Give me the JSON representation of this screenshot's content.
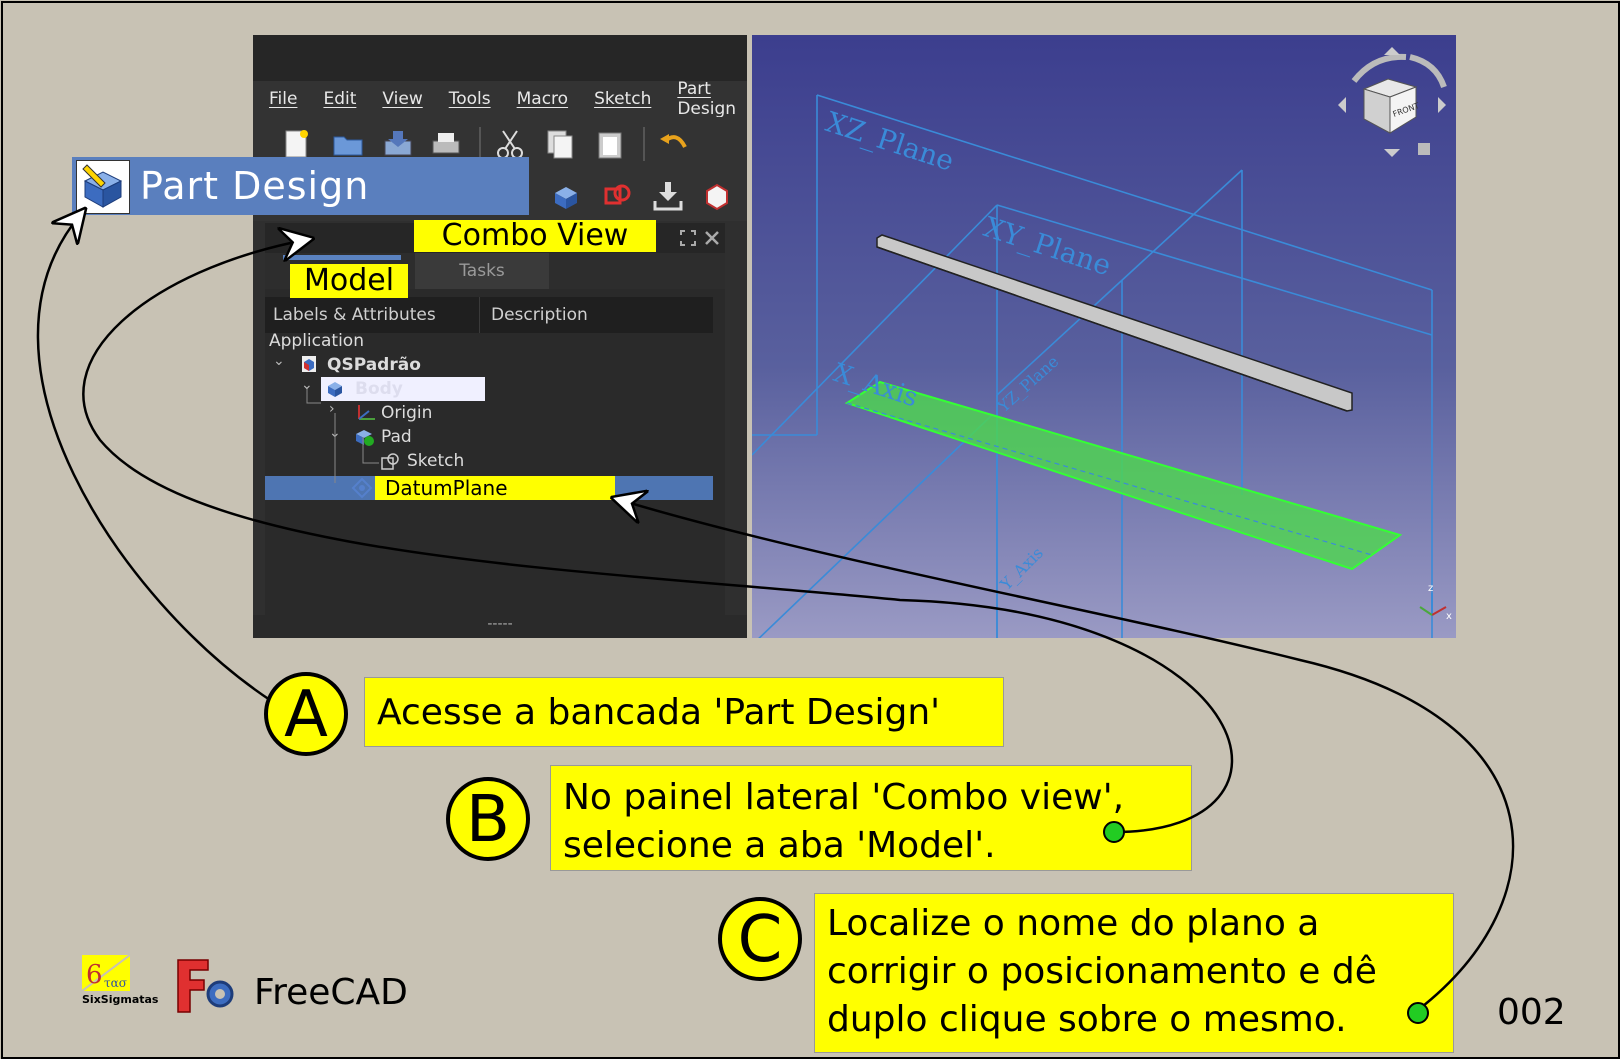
{
  "menu": {
    "items": [
      "File",
      "Edit",
      "View",
      "Tools",
      "Macro",
      "Sketch",
      "Part Design"
    ]
  },
  "workbench": {
    "label": "Part Design"
  },
  "combo": {
    "title": "Combo View",
    "tab_model": "Model",
    "tab_tasks": "Tasks",
    "col_labels": "Labels & Attributes",
    "col_description": "Description",
    "grip": "-----"
  },
  "tree": {
    "application": "Application",
    "document": "QSPadrão",
    "body": "Body",
    "origin": "Origin",
    "pad": "Pad",
    "sketch": "Sketch",
    "datum": "DatumPlane"
  },
  "viewport": {
    "plane_xz": "XZ_Plane",
    "plane_xy": "XY_Plane",
    "plane_yz": "YZ_Plane",
    "axis_x": "X_Axis",
    "axis_y": "Y_Axis",
    "navcube_face": "FRONT",
    "axis_z_label": "z",
    "axis_x_label": "x"
  },
  "steps": {
    "a_letter": "A",
    "a_text": "Acesse a bancada 'Part Design'",
    "b_letter": "B",
    "b_line1": "No painel lateral 'Combo view',",
    "b_line2": "selecione a aba 'Model'.",
    "c_letter": "C",
    "c_line1": "Localize o nome do plano a",
    "c_line2": "corrigir o posicionamento e dê",
    "c_line3": "duplo clique sobre o mesmo."
  },
  "footer": {
    "logo_text": "SixSigmatas",
    "app_name": "FreeCAD",
    "page_number": "002"
  },
  "colors": {
    "background": "#c8c2b4",
    "highlight": "#ffff00",
    "selection": "#4e75b2",
    "workbench_tab": "#5a7fbe",
    "green_dot": "#22cc22"
  }
}
